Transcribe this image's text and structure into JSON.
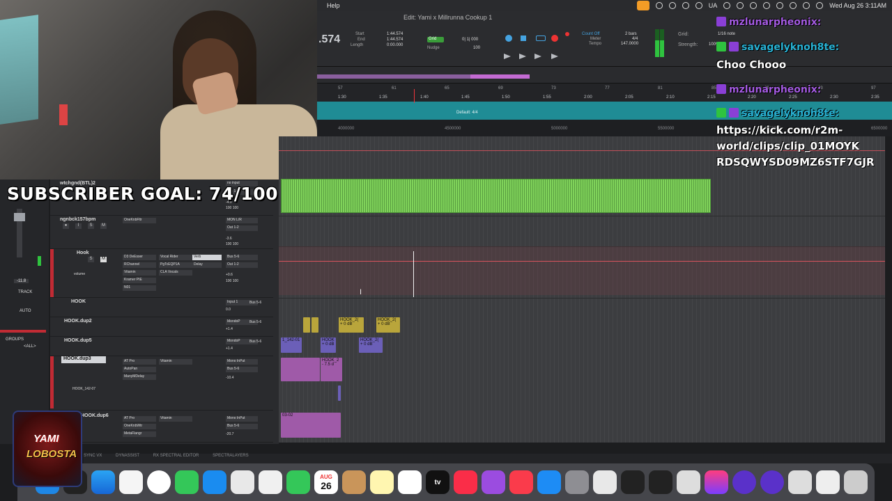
{
  "menubar": {
    "help": "Help",
    "keyboard": "UA",
    "datetime": "Wed Aug 26  3:11AM"
  },
  "session": {
    "title": "Edit: Yami x Millrunna Cookup 1"
  },
  "transport": {
    "counter": ".574",
    "start_label": "Start",
    "start_value": "1:44.574",
    "end_label": "End",
    "end_value": "1:44.574",
    "length_label": "Length",
    "length_value": "0:00.000",
    "grid_label": "Grid",
    "grid_value": "0| 1| 000",
    "nudge_label": "Nudge",
    "nudge_value": "100",
    "count_off": "Count Off",
    "meter_label": "Meter",
    "tempo_label": "Tempo",
    "bars": "2 bars",
    "meter_value": "4/4",
    "tempo_value": "147.0000",
    "grid_right_label": "Grid:",
    "grid_note": "1/16 note",
    "strength_label": "Strength:",
    "strength_value": "100%"
  },
  "rulers": {
    "bars": [
      "57",
      "61",
      "65",
      "69",
      "73",
      "77",
      "81",
      "85",
      "89",
      "93",
      "97"
    ],
    "minsecs": [
      "1:30",
      "1:35",
      "1:40",
      "1:45",
      "1:50",
      "1:55",
      "2:00",
      "2:05",
      "2:10",
      "2:15",
      "2:20",
      "2:25",
      "2:30",
      "2:35"
    ],
    "meter_default": "Default: 4/4",
    "samples": [
      "4000000",
      "4500000",
      "5000000",
      "5500000",
      "6000000",
      "6500000"
    ]
  },
  "tracks": [
    {
      "name": "wtchgnd(BTL)2",
      "input": "no input",
      "output": "Out 1-2",
      "vol": "-4.0",
      "pan": "100  100"
    },
    {
      "name": "ngnbck157bpm",
      "insert": "OneKnbFltr",
      "input": "MON L/R",
      "output": "Out 1-2",
      "vol": "-3.6",
      "pan": "100  100"
    },
    {
      "name": "Hook",
      "inserts": [
        "D3 DeEsser",
        "RChannel",
        "Vitamin",
        "Kramer PIE",
        "N01"
      ],
      "inserts2": [
        "Vocal Rider",
        "PgTcEQP1A",
        "CLA Vocals"
      ],
      "sends": [
        "Verb",
        "Delay"
      ],
      "input": "Bus 5-6",
      "output": "Out 1-2",
      "vol": "+0.6",
      "pan": "100  100",
      "mode1": "volume"
    },
    {
      "name": "HOOK",
      "input": "Input 1",
      "output": "Bus 5-6",
      "vol": "0.0"
    },
    {
      "name": "HOOK.dup2",
      "input": "MondoP",
      "output": "Bus 5-6",
      "vol": "+1.4"
    },
    {
      "name": "HOOK.dup5",
      "input": "MondoP",
      "output": "Bus 5-6",
      "vol": "+1.4"
    },
    {
      "name": "HOOK.dup3",
      "inserts": [
        "AT Pro",
        "AutoPan",
        "ManyMDelay"
      ],
      "inserts2": [
        "Vitamin"
      ],
      "input": "Mono InPut",
      "output": "Bus 5-6",
      "vol": "-10.4",
      "playlist": "HOOK_142-07"
    },
    {
      "name": "HOOK.dup6",
      "inserts": [
        "AT Pro",
        "OneKnbWtr",
        "MetaFlangr"
      ],
      "inserts2": [
        "Vitamin"
      ],
      "input": "Mono InPut",
      "output": "Bus 5-6",
      "vol": "-20.7"
    }
  ],
  "mix_left": {
    "level": "-11.8",
    "track_label": "TRACK",
    "auto_label": "AUTO",
    "groups_label": "GROUPS",
    "all_label": "<ALL>"
  },
  "clips": {
    "hook_dup2_a": "HOOK_2(",
    "hook_dup2_b": "HOOK_2(",
    "hook_dup2_a_vol": "+ 0 dB",
    "hook_dup2_b_vol": "+ 0 dB",
    "hook_dup5_a": "1_142-01",
    "hook_dup5_b": "HOOK",
    "hook_dup5_c": "HOOK_2(",
    "hook_dup5_vol": "+ 0 dB",
    "hook_dup3": "HOOK_2",
    "hook_dup3_vol": "- 7.5 d",
    "dup6": "03-02"
  },
  "subscriber_goal": "SUBSCRIBER GOAL: 74/100",
  "chat": [
    {
      "user": "mzlunarpheonix:",
      "color": "purple"
    },
    {
      "user": "savagelyknoh8te:",
      "color": "cyan"
    },
    {
      "message": "Choo Chooo"
    },
    {
      "user": "mzlunarpheonix:",
      "color": "purple"
    },
    {
      "user": "savagelyknoh8te:",
      "color": "cyan"
    },
    {
      "message": "https://kick.com/r2m-"
    },
    {
      "message": "world/clips/clip_01MOYK"
    },
    {
      "message": "RDSQWYSD09MZ6STF7GJR"
    }
  ],
  "plugins_bar": [
    "SYNC VX",
    "DYNASSIST",
    "RX SPECTRAL EDITOR",
    "SPECTRALAYERS"
  ],
  "dock": {
    "calendar_month": "AUG",
    "calendar_day": "26",
    "appletv": "tv"
  },
  "logo": {
    "line1": "YAMI",
    "line2": "LOBOSTA"
  },
  "colors": {
    "accent_green": "#7fd25a",
    "timeline_teal": "#1f8c95",
    "chat_purple": "#a45be2",
    "chat_cyan": "#28b3d6",
    "record_red": "#e33333"
  }
}
